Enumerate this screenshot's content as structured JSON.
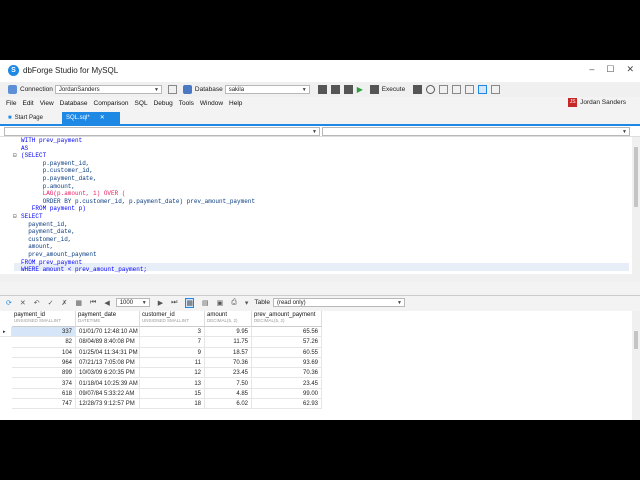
{
  "app": {
    "title": "dbForge Studio for MySQL",
    "logo_letter": "S"
  },
  "toolbar": {
    "connection_label": "Connection",
    "connection_value": "JordanSanders",
    "database_label": "Database",
    "database_value": "sakila",
    "execute_label": "Execute"
  },
  "menu": [
    "File",
    "Edit",
    "View",
    "Database",
    "Comparison",
    "SQL",
    "Debug",
    "Tools",
    "Window",
    "Help"
  ],
  "user": {
    "name": "Jordan Sanders",
    "initials": "JS"
  },
  "tabs": {
    "start": "Start Page",
    "active": "SQL.sql*"
  },
  "sql_lines": [
    "WITH prev_payment",
    "AS",
    "(SELECT",
    "      p.payment_id,",
    "      p.customer_id,",
    "      p.payment_date,",
    "      p.amount,",
    "      LAG(p.amount, 1) OVER (",
    "      ORDER BY p.customer_id, p.payment_date) prev_amount_payment",
    "   FROM payment p)",
    "SELECT",
    "  payment_id,",
    "  payment_date,",
    "  customer_id,",
    "  amount,",
    "  prev_amount_payment",
    "FROM prev_payment",
    "WHERE amount < prev_amount_payment;"
  ],
  "grid_toolbar": {
    "page_size": "1000",
    "view_label": "Table",
    "mode": "(read only)"
  },
  "columns": [
    {
      "name": "payment_id",
      "type": "UNSIGNED SMALLINT"
    },
    {
      "name": "payment_date",
      "type": "DATETIME"
    },
    {
      "name": "customer_id",
      "type": "UNSIGNED SMALLINT"
    },
    {
      "name": "amount",
      "type": "DECIMAL(5, 2)"
    },
    {
      "name": "prev_amount_payment",
      "type": "DECIMAL(5, 2)"
    }
  ],
  "rows": [
    [
      "337",
      "01/01/70 12:48:10 AM",
      "3",
      "9.95",
      "65.56"
    ],
    [
      "82",
      "08/04/89 8:40:08 PM",
      "7",
      "11.75",
      "57.26"
    ],
    [
      "104",
      "01/25/04 11:34:31 PM",
      "9",
      "18.57",
      "60.55"
    ],
    [
      "964",
      "07/21/13 7:05:08 PM",
      "11",
      "70.36",
      "93.69"
    ],
    [
      "899",
      "10/03/09 6:20:35 PM",
      "12",
      "23.45",
      "70.36"
    ],
    [
      "374",
      "01/18/04 10:25:39 AM",
      "13",
      "7.50",
      "23.45"
    ],
    [
      "618",
      "09/07/84 5:33:22 AM",
      "15",
      "4.85",
      "99.00"
    ],
    [
      "747",
      "12/28/73 9:12:57 PM",
      "18",
      "6.02",
      "62.93"
    ]
  ]
}
